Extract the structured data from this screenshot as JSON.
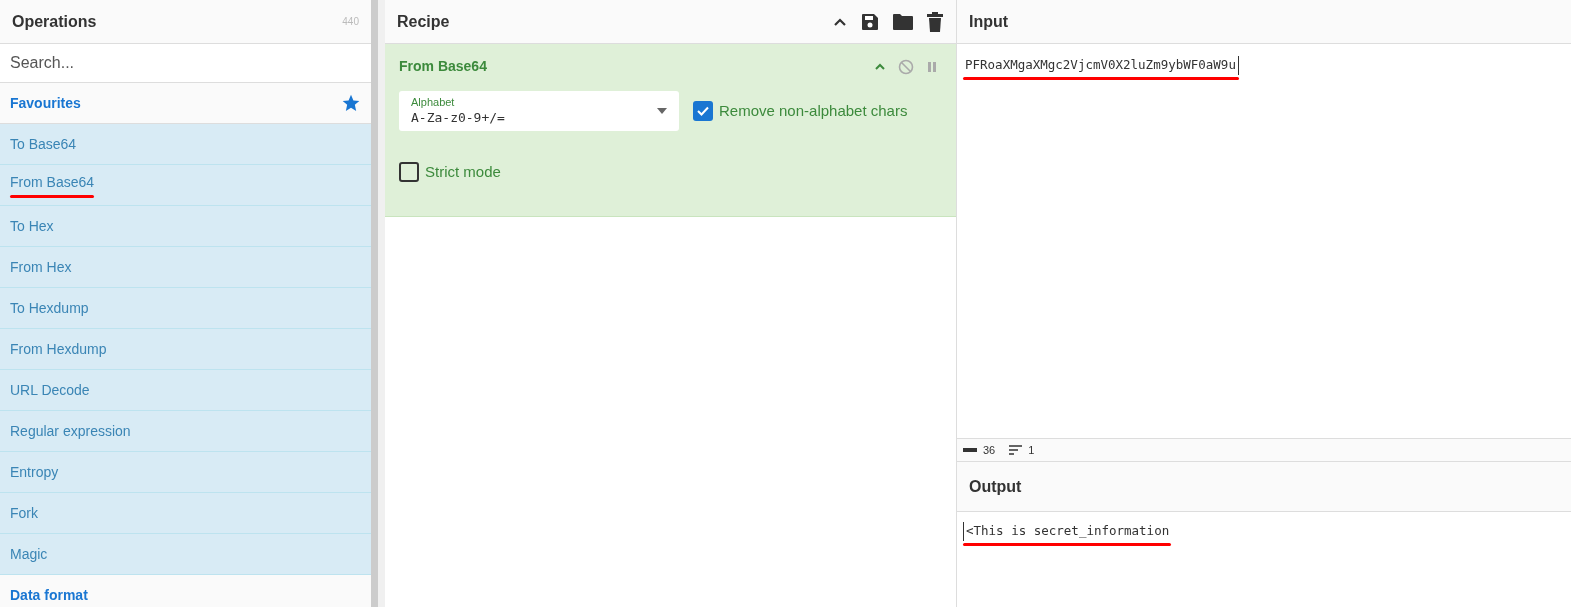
{
  "operations": {
    "title": "Operations",
    "count": "440",
    "search": {
      "placeholder": "Search..."
    },
    "categories": [
      {
        "name": "Favourites",
        "starred": true,
        "items": [
          {
            "label": "To Base64",
            "underlined": false
          },
          {
            "label": "From Base64",
            "underlined": true
          },
          {
            "label": "To Hex",
            "underlined": false
          },
          {
            "label": "From Hex",
            "underlined": false
          },
          {
            "label": "To Hexdump",
            "underlined": false
          },
          {
            "label": "From Hexdump",
            "underlined": false
          },
          {
            "label": "URL Decode",
            "underlined": false
          },
          {
            "label": "Regular expression",
            "underlined": false
          },
          {
            "label": "Entropy",
            "underlined": false
          },
          {
            "label": "Fork",
            "underlined": false
          },
          {
            "label": "Magic",
            "underlined": false
          }
        ]
      },
      {
        "name": "Data format",
        "starred": false
      }
    ]
  },
  "recipe": {
    "title": "Recipe",
    "operation": {
      "name": "From Base64",
      "alphabet": {
        "label": "Alphabet",
        "value": "A-Za-z0-9+/="
      },
      "options": [
        {
          "label": "Remove non-alphabet chars",
          "checked": true
        },
        {
          "label": "Strict mode",
          "checked": false
        }
      ]
    }
  },
  "input": {
    "title": "Input",
    "value": "PFRoaXMgaXMgc2VjcmV0X2luZm9ybWF0aW9u",
    "underlined": true,
    "chars": "36",
    "lines": "1"
  },
  "output": {
    "title": "Output",
    "value": "<This is secret_information",
    "underlined": true
  }
}
